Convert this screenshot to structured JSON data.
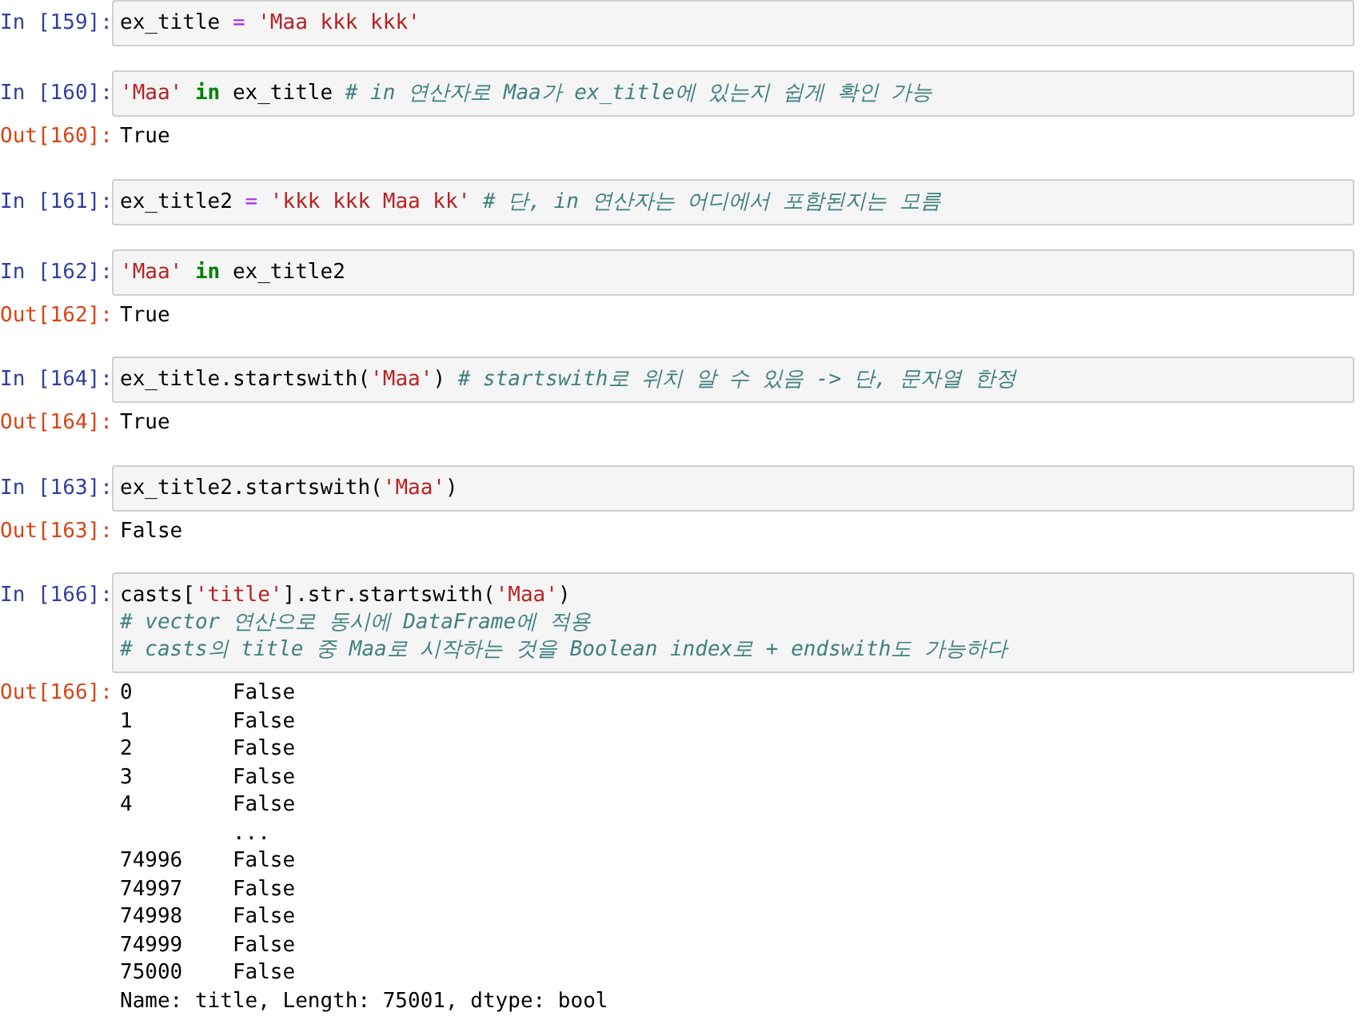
{
  "cells": [
    {
      "prompt": "In [159]:",
      "code": [
        [
          {
            "kind": "name",
            "text": "ex_title "
          },
          {
            "kind": "operator",
            "text": "="
          },
          {
            "kind": "string",
            "text": " 'Maa kkk kkk'"
          }
        ]
      ]
    },
    {
      "prompt": "In [160]:",
      "code": [
        [
          {
            "kind": "string",
            "text": "'Maa' "
          },
          {
            "kind": "keyword",
            "text": "in"
          },
          {
            "kind": "name",
            "text": " ex_title "
          },
          {
            "kind": "comment",
            "text": "# in 연산자로 Maa가 ex_title에 있는지 쉽게 확인 가능"
          }
        ]
      ],
      "output": {
        "prompt": "Out[160]:",
        "lines": [
          "True"
        ]
      }
    },
    {
      "prompt": "In [161]:",
      "code": [
        [
          {
            "kind": "name",
            "text": "ex_title2 "
          },
          {
            "kind": "operator",
            "text": "="
          },
          {
            "kind": "string",
            "text": " 'kkk kkk Maa kk'"
          },
          {
            "kind": "comment",
            "text": " # 단, in 연산자는 어디에서 포함된지는 모름"
          }
        ]
      ]
    },
    {
      "prompt": "In [162]:",
      "code": [
        [
          {
            "kind": "string",
            "text": "'Maa' "
          },
          {
            "kind": "keyword",
            "text": "in"
          },
          {
            "kind": "name",
            "text": " ex_title2"
          }
        ]
      ],
      "output": {
        "prompt": "Out[162]:",
        "lines": [
          "True"
        ]
      }
    },
    {
      "prompt": "In [164]:",
      "code": [
        [
          {
            "kind": "name",
            "text": "ex_title.startswith("
          },
          {
            "kind": "string",
            "text": "'Maa'"
          },
          {
            "kind": "name",
            "text": ") "
          },
          {
            "kind": "comment",
            "text": "# startswith로 위치 알 수 있음 -> 단, 문자열 한정"
          }
        ]
      ],
      "output": {
        "prompt": "Out[164]:",
        "lines": [
          "True"
        ]
      }
    },
    {
      "prompt": "In [163]:",
      "code": [
        [
          {
            "kind": "name",
            "text": "ex_title2.startswith("
          },
          {
            "kind": "string",
            "text": "'Maa'"
          },
          {
            "kind": "name",
            "text": ")"
          }
        ]
      ],
      "output": {
        "prompt": "Out[163]:",
        "lines": [
          "False"
        ]
      }
    },
    {
      "prompt": "In [166]:",
      "code": [
        [
          {
            "kind": "name",
            "text": "casts["
          },
          {
            "kind": "string",
            "text": "'title'"
          },
          {
            "kind": "name",
            "text": "].str.startswith("
          },
          {
            "kind": "string",
            "text": "'Maa'"
          },
          {
            "kind": "name",
            "text": ")"
          }
        ],
        [
          {
            "kind": "comment",
            "text": "# vector 연산으로 동시에 DataFrame에 적용"
          }
        ],
        [
          {
            "kind": "comment",
            "text": "# casts의 title 중 Maa로 시작하는 것을 Boolean index로 + endswith도 가능하다"
          }
        ]
      ],
      "output": {
        "prompt": "Out[166]:",
        "lines": [
          "0        False",
          "1        False",
          "2        False",
          "3        False",
          "4        False",
          "         ...",
          "74996    False",
          "74997    False",
          "74998    False",
          "74999    False",
          "75000    False",
          "Name: title, Length: 75001, dtype: bool"
        ]
      }
    }
  ]
}
